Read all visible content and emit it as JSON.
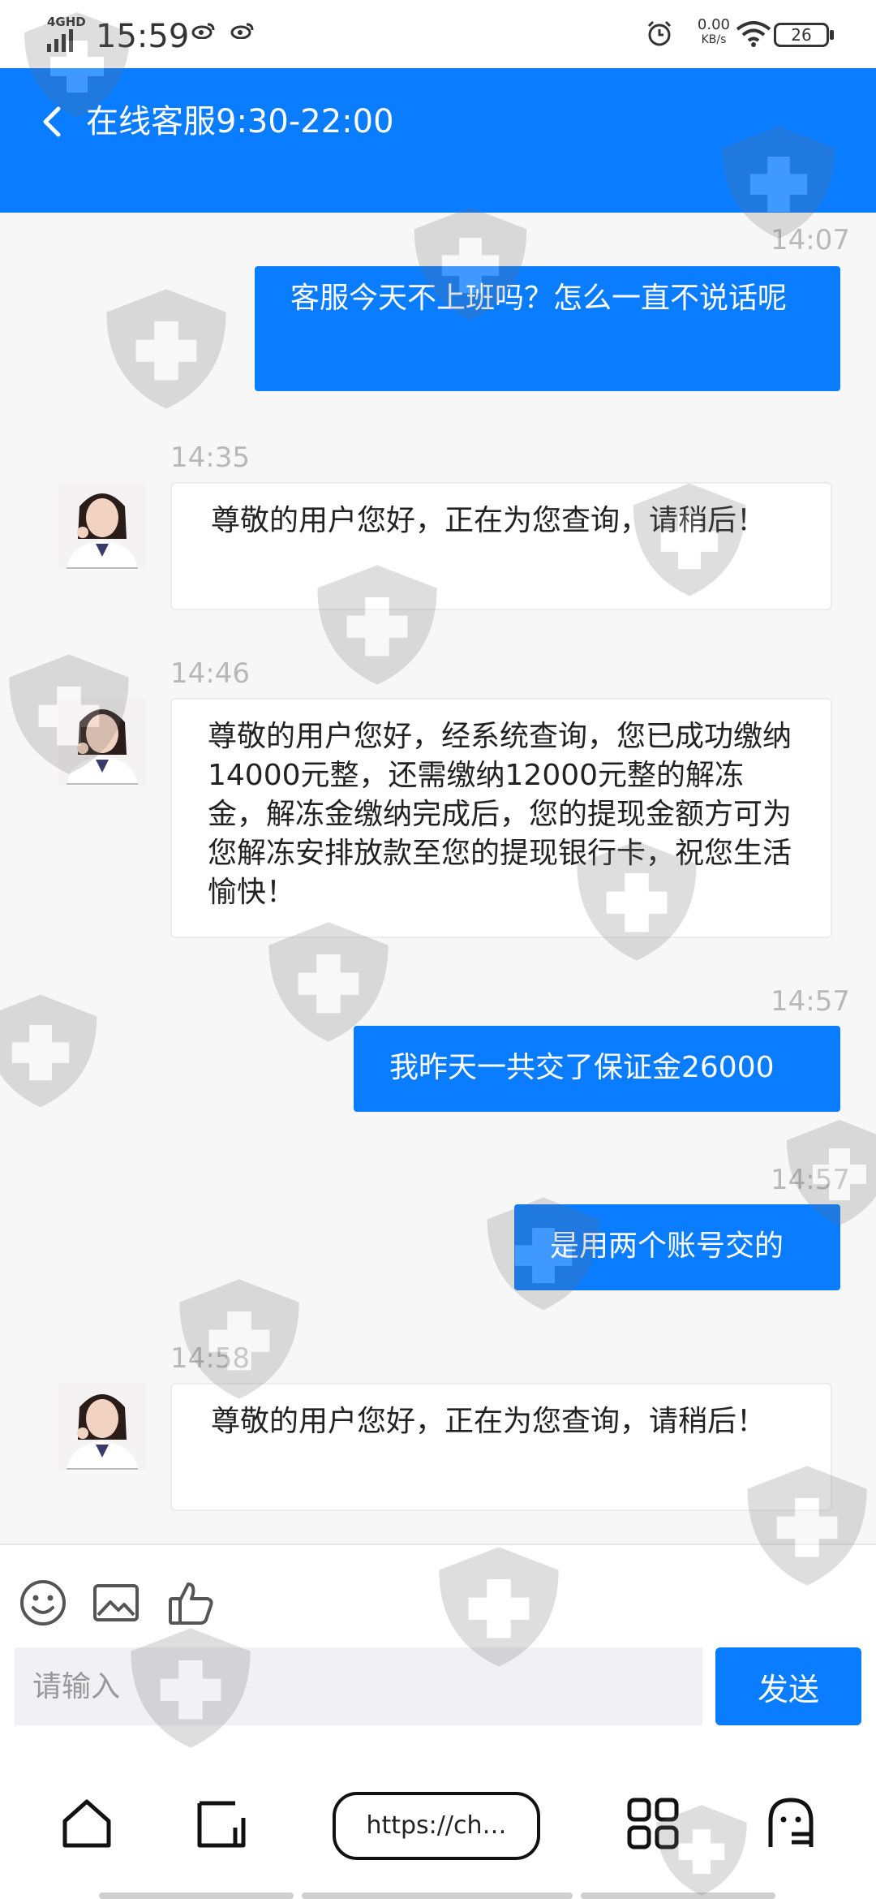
{
  "status_bar": {
    "network": "4GHD",
    "time": "15:59",
    "speed_value": "0.00",
    "speed_unit": "KB/s",
    "battery": "26"
  },
  "header": {
    "title": "在线客服9:30-22:00"
  },
  "messages": [
    {
      "time": "14:07",
      "side": "right",
      "text": "客服今天不上班吗？怎么一直不说话呢"
    },
    {
      "time": "14:35",
      "side": "left",
      "text": "尊敬的用户您好，正在为您查询，请稍后！"
    },
    {
      "time": "14:46",
      "side": "left",
      "text": "尊敬的用户您好，经系统查询，您已成功缴纳14000元整，还需缴纳12000元整的解冻金，解冻金缴纳完成后，您的提现金额方可为您解冻安排放款至您的提现银行卡，祝您生活愉快！"
    },
    {
      "time": "14:57",
      "side": "right",
      "text": "我昨天一共交了保证金26000"
    },
    {
      "time": "14:57",
      "side": "right",
      "text": "是用两个账号交的"
    },
    {
      "time": "14:58",
      "side": "left",
      "text": "尊敬的用户您好，正在为您查询，请稍后！"
    }
  ],
  "input": {
    "placeholder": "请输入",
    "send_label": "发送"
  },
  "browser": {
    "url": "https://ch…"
  },
  "colors": {
    "accent": "#0a7cff",
    "background": "#f7f7f7"
  }
}
